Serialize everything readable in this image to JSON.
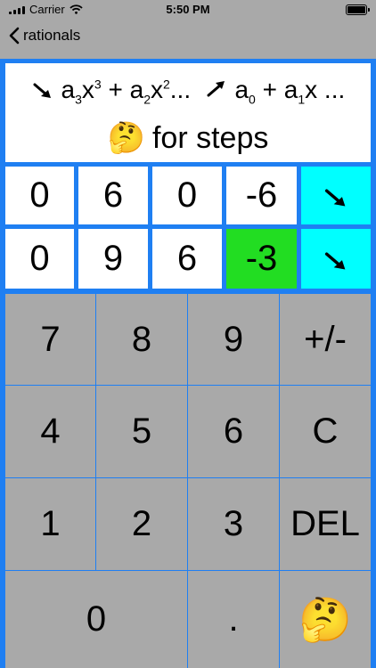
{
  "status": {
    "carrier": "Carrier",
    "time": "5:50 PM"
  },
  "nav": {
    "back_label": "rationals"
  },
  "header": {
    "f1_a": "a",
    "f1_a_sub": "3",
    "f1_x": "x",
    "f1_x_sup": "3",
    "f1_plus": " + ",
    "f1_b": "a",
    "f1_b_sub": "2",
    "f1_y": "x",
    "f1_y_sup": "2",
    "f1_dots": "...",
    "f2_a": "a",
    "f2_a_sub": "0",
    "f2_plus": " + ",
    "f2_b": "a",
    "f2_b_sub": "1",
    "f2_x": "x",
    "f2_dots": " ...",
    "steps_emoji": "🤔",
    "steps_label": "for steps"
  },
  "rows": [
    [
      "0",
      "6",
      "0",
      "-6"
    ],
    [
      "0",
      "9",
      "6",
      "-3"
    ]
  ],
  "active_cell": {
    "row": 1,
    "col": 3
  },
  "keypad": {
    "k7": "7",
    "k8": "8",
    "k9": "9",
    "kneg": "+/-",
    "k4": "4",
    "k5": "5",
    "k6": "6",
    "kc": "C",
    "k1": "1",
    "k2": "2",
    "k3": "3",
    "kdel": "DEL",
    "k0": "0",
    "kdot": ".",
    "kthink": "🤔"
  },
  "colors": {
    "accent": "#1f7ff2",
    "active": "#22dd22",
    "go": "#00ffff",
    "key": "#a9a9a9"
  },
  "icons": [
    "back-chevron-icon",
    "arrow-down-right-icon",
    "arrow-up-right-icon",
    "thinking-face-icon"
  ]
}
